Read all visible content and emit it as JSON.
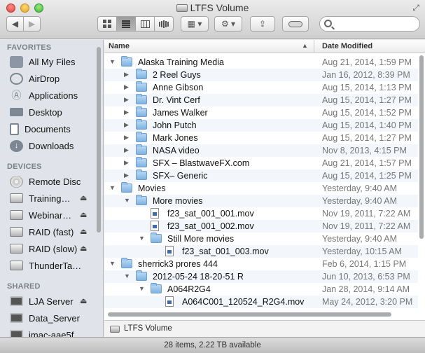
{
  "window": {
    "title": "LTFS Volume"
  },
  "toolbar": {
    "back_glyph": "◀",
    "forward_glyph": "▶",
    "views": [
      "icon-view",
      "list-view",
      "column-view",
      "coverflow-view"
    ],
    "arrange_glyph": "▦ ▾",
    "action_glyph": "⚙ ▾",
    "share_glyph": "⇪",
    "search_placeholder": ""
  },
  "sidebar": {
    "favorites_header": "FAVORITES",
    "favorites": [
      {
        "label": "All My Files",
        "icon": "all-files-icon"
      },
      {
        "label": "AirDrop",
        "icon": "airdrop-icon"
      },
      {
        "label": "Applications",
        "icon": "applications-icon"
      },
      {
        "label": "Desktop",
        "icon": "desktop-icon"
      },
      {
        "label": "Documents",
        "icon": "documents-icon"
      },
      {
        "label": "Downloads",
        "icon": "downloads-icon"
      }
    ],
    "devices_header": "DEVICES",
    "devices": [
      {
        "label": "Remote Disc",
        "eject": false
      },
      {
        "label": "Training…",
        "eject": true
      },
      {
        "label": "Webinar…",
        "eject": true
      },
      {
        "label": "RAID (fast)",
        "eject": true
      },
      {
        "label": "RAID (slow)",
        "eject": true
      },
      {
        "label": "ThunderTa…",
        "eject": false
      }
    ],
    "shared_header": "SHARED",
    "shared": [
      {
        "label": "LJA Server",
        "eject": true
      },
      {
        "label": "Data_Server",
        "eject": false
      },
      {
        "label": "imac-aae5fa…",
        "eject": false
      }
    ],
    "eject_glyph": "⏏"
  },
  "columns": {
    "name": "Name",
    "date": "Date Modified",
    "sort_glyph": "▲"
  },
  "files": [
    {
      "name": "Alaska Training Media",
      "date": "Aug 21, 2014, 1:59 PM",
      "depth": 0,
      "kind": "folder",
      "disclosure": "open"
    },
    {
      "name": "2 Reel Guys",
      "date": "Jan 16, 2012, 8:39 PM",
      "depth": 1,
      "kind": "folder",
      "disclosure": "closed"
    },
    {
      "name": "Anne Gibson",
      "date": "Aug 15, 2014, 1:13 PM",
      "depth": 1,
      "kind": "folder",
      "disclosure": "closed"
    },
    {
      "name": "Dr. Vint Cerf",
      "date": "Aug 15, 2014, 1:27 PM",
      "depth": 1,
      "kind": "folder",
      "disclosure": "closed"
    },
    {
      "name": "James Walker",
      "date": "Aug 15, 2014, 1:52 PM",
      "depth": 1,
      "kind": "folder",
      "disclosure": "closed"
    },
    {
      "name": "John Putch",
      "date": "Aug 15, 2014, 1:40 PM",
      "depth": 1,
      "kind": "folder",
      "disclosure": "closed"
    },
    {
      "name": "Mark Jones",
      "date": "Aug 15, 2014, 1:27 PM",
      "depth": 1,
      "kind": "folder",
      "disclosure": "closed"
    },
    {
      "name": "NASA video",
      "date": "Nov 8, 2013, 4:15 PM",
      "depth": 1,
      "kind": "folder",
      "disclosure": "closed"
    },
    {
      "name": "SFX – BlastwaveFX.com",
      "date": "Aug 21, 2014, 1:57 PM",
      "depth": 1,
      "kind": "folder",
      "disclosure": "closed"
    },
    {
      "name": "SFX– Generic",
      "date": "Aug 15, 2014, 1:25 PM",
      "depth": 1,
      "kind": "folder",
      "disclosure": "closed"
    },
    {
      "name": "Movies",
      "date": "Yesterday, 9:40 AM",
      "depth": 0,
      "kind": "folder",
      "disclosure": "open"
    },
    {
      "name": "More movies",
      "date": "Yesterday, 9:40 AM",
      "depth": 1,
      "kind": "folder",
      "disclosure": "open"
    },
    {
      "name": "f23_sat_001_001.mov",
      "date": "Nov 19, 2011, 7:22 AM",
      "depth": 2,
      "kind": "movie",
      "disclosure": "none"
    },
    {
      "name": "f23_sat_001_002.mov",
      "date": "Nov 19, 2011, 7:22 AM",
      "depth": 2,
      "kind": "movie",
      "disclosure": "none"
    },
    {
      "name": "Still More movies",
      "date": "Yesterday, 9:40 AM",
      "depth": 2,
      "kind": "folder",
      "disclosure": "open"
    },
    {
      "name": "f23_sat_001_003.mov",
      "date": "Yesterday, 10:15 AM",
      "depth": 3,
      "kind": "movie",
      "disclosure": "none"
    },
    {
      "name": "sherrick3 prores 444",
      "date": "Feb 6, 2014, 1:15 PM",
      "depth": 0,
      "kind": "folder",
      "disclosure": "open"
    },
    {
      "name": "2012-05-24 18-20-51 R",
      "date": "Jun 10, 2013, 6:53 PM",
      "depth": 1,
      "kind": "folder",
      "disclosure": "open"
    },
    {
      "name": "A064R2G4",
      "date": "Jan 28, 2014, 9:14 AM",
      "depth": 2,
      "kind": "folder",
      "disclosure": "open"
    },
    {
      "name": "A064C001_120524_R2G4.mov",
      "date": "May 24, 2012, 3:20 PM",
      "depth": 3,
      "kind": "movie",
      "disclosure": "none"
    }
  ],
  "pathbar": {
    "label": "LTFS Volume"
  },
  "status": {
    "text": "28 items, 2.22 TB available"
  }
}
